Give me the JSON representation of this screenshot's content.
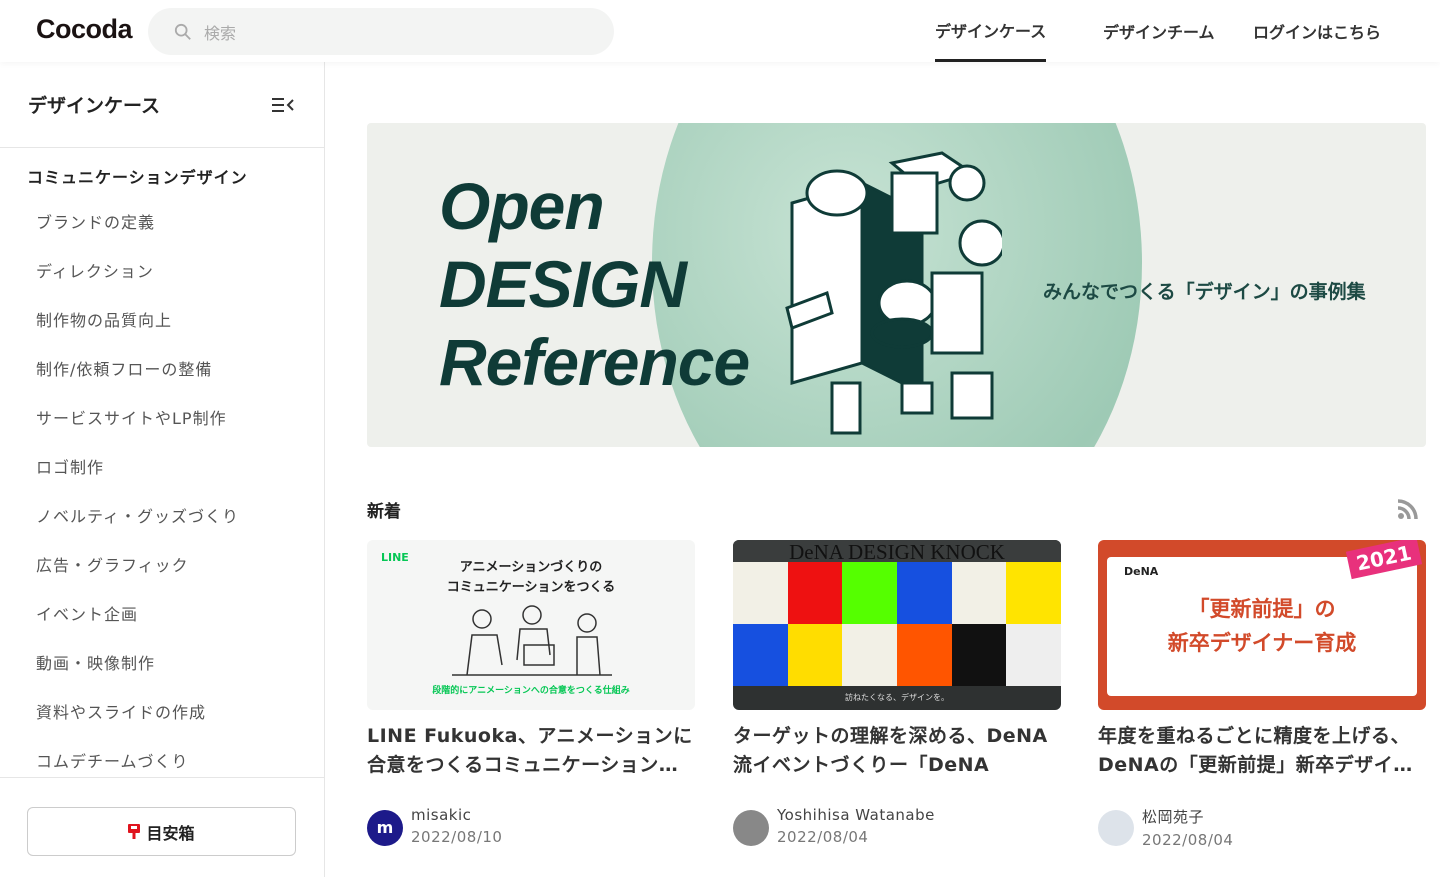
{
  "header": {
    "logo": "Cocoda",
    "search_placeholder": "検索",
    "nav": [
      {
        "label": "デザインケース",
        "active": true
      },
      {
        "label": "デザインチーム"
      },
      {
        "label": "ログインはこちら"
      }
    ]
  },
  "sidebar": {
    "title": "デザインケース",
    "category": "コミュニケーションデザイン",
    "items": [
      "ブランドの定義",
      "ディレクション",
      "制作物の品質向上",
      "制作/依頼フローの整備",
      "サービスサイトやLP制作",
      "ロゴ制作",
      "ノベルティ・グッズづくり",
      "広告・グラフィック",
      "イベント企画",
      "動画・映像制作",
      "資料やスライドの作成",
      "コムデチームづくり"
    ],
    "goal_button": "目安箱"
  },
  "banner": {
    "title_lines": [
      "Open",
      "DESIGN",
      "Reference"
    ],
    "subtitle": "みんなでつくる「デザイン」の事例集"
  },
  "section": {
    "title": "新着"
  },
  "cards": [
    {
      "thumb": {
        "brand": "LINE",
        "headline1": "アニメーションづくりの",
        "headline2": "コミュニケーションをつくる",
        "caption": "段階的にアニメーションへの合意をつくる仕組み"
      },
      "title": "LINE Fukuoka、アニメーションに合意をつくるコミュニケーション…",
      "author": "misakic",
      "date": "2022/08/10",
      "avatar_color": "#1d1a8a"
    },
    {
      "thumb": {
        "headline": "DeNA DESIGN KNOCK",
        "caption": "訪ねたくなる、デザインを。"
      },
      "title": "ターゲットの理解を深める、DeNA流イベントづくりー「DeNA DESI…",
      "author": "Yoshihisa Watanabe",
      "date": "2022/08/04",
      "avatar_color": "#777777"
    },
    {
      "thumb": {
        "brand": "DeNA",
        "headline1": "「更新前提」の",
        "headline2": "新卒デザイナー育成",
        "badge": "2021"
      },
      "title": "年度を重ねるごとに精度を上げる、DeNAの「更新前提」新卒デザイ…",
      "author": "松岡苑子",
      "date": "2022/08/04",
      "avatar_color": "#dde3ea"
    }
  ]
}
